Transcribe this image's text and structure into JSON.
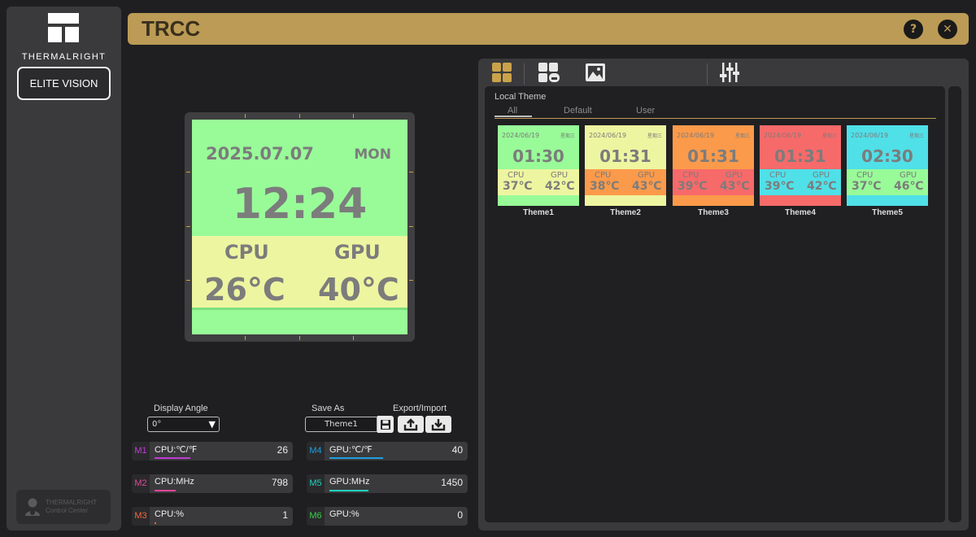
{
  "app": {
    "title": "TRCC",
    "help_label": "?",
    "close_label": "✕",
    "accent": "#bb9b55"
  },
  "sidebar": {
    "brand": "THERMALRIGHT",
    "device_button": "ELITE VISION",
    "control_center_line1": "THERMALRIGHT",
    "control_center_line2": "Control Center"
  },
  "preview": {
    "date": "2025.07.07",
    "weekday": "MON",
    "time": "12:24",
    "cpu_label": "CPU",
    "gpu_label": "GPU",
    "cpu_temp": "26°C",
    "gpu_temp": "40°C",
    "background": "#98fb98",
    "band_color": "#eef5a0"
  },
  "controls": {
    "display_angle_label": "Display Angle",
    "display_angle_value": "0°",
    "save_as_label": "Save As",
    "save_as_value": "Theme1",
    "export_import_label": "Export/Import"
  },
  "monitors": [
    {
      "tag": "M1",
      "name": "CPU:℃/℉",
      "value": "26",
      "color": "#c23bd6"
    },
    {
      "tag": "M2",
      "name": "CPU:MHz",
      "value": "798",
      "color": "#e0479a"
    },
    {
      "tag": "M3",
      "name": "CPU:%",
      "value": "1",
      "color": "#f0663c"
    },
    {
      "tag": "M4",
      "name": "GPU:℃/℉",
      "value": "40",
      "color": "#1fa0e0"
    },
    {
      "tag": "M5",
      "name": "GPU:MHz",
      "value": "1450",
      "color": "#20d2c0"
    },
    {
      "tag": "M6",
      "name": "GPU:%",
      "value": "0",
      "color": "#39d24a"
    }
  ],
  "theme_panel": {
    "section_title": "Local Theme",
    "filter_tabs": [
      "All",
      "Default",
      "User"
    ],
    "active_tab": "All",
    "themes": [
      {
        "name": "Theme1",
        "date": "2024/06/19",
        "weekday": "星期三",
        "time": "01:30",
        "cpu_label": "CPU",
        "gpu_label": "GPU",
        "cpu": "37℃",
        "gpu": "42℃",
        "bg": "#98fb98",
        "band": "#eef5a0"
      },
      {
        "name": "Theme2",
        "date": "2024/06/19",
        "weekday": "星期三",
        "time": "01:31",
        "cpu_label": "CPU",
        "gpu_label": "GPU",
        "cpu": "38℃",
        "gpu": "43℃",
        "bg": "#eef5a0",
        "band": "#fb9a4a"
      },
      {
        "name": "Theme3",
        "date": "2024/06/19",
        "weekday": "星期三",
        "time": "01:31",
        "cpu_label": "CPU",
        "gpu_label": "GPU",
        "cpu": "39℃",
        "gpu": "43℃",
        "bg": "#fb9a4a",
        "band": "#f76a6a"
      },
      {
        "name": "Theme4",
        "date": "2024/06/19",
        "weekday": "星期三",
        "time": "01:31",
        "cpu_label": "CPU",
        "gpu_label": "GPU",
        "cpu": "39℃",
        "gpu": "42℃",
        "bg": "#f76a6a",
        "band": "#4fe0e8"
      },
      {
        "name": "Theme5",
        "date": "2024/06/19",
        "weekday": "星期三",
        "time": "02:30",
        "cpu_label": "CPU",
        "gpu_label": "GPU",
        "cpu": "37℃",
        "gpu": "46℃",
        "bg": "#4fe0e8",
        "band": "#98fb98"
      }
    ]
  },
  "toolbar_icons": [
    "local-themes-icon",
    "cloud-themes-icon",
    "image-icon",
    "sliders-icon"
  ]
}
